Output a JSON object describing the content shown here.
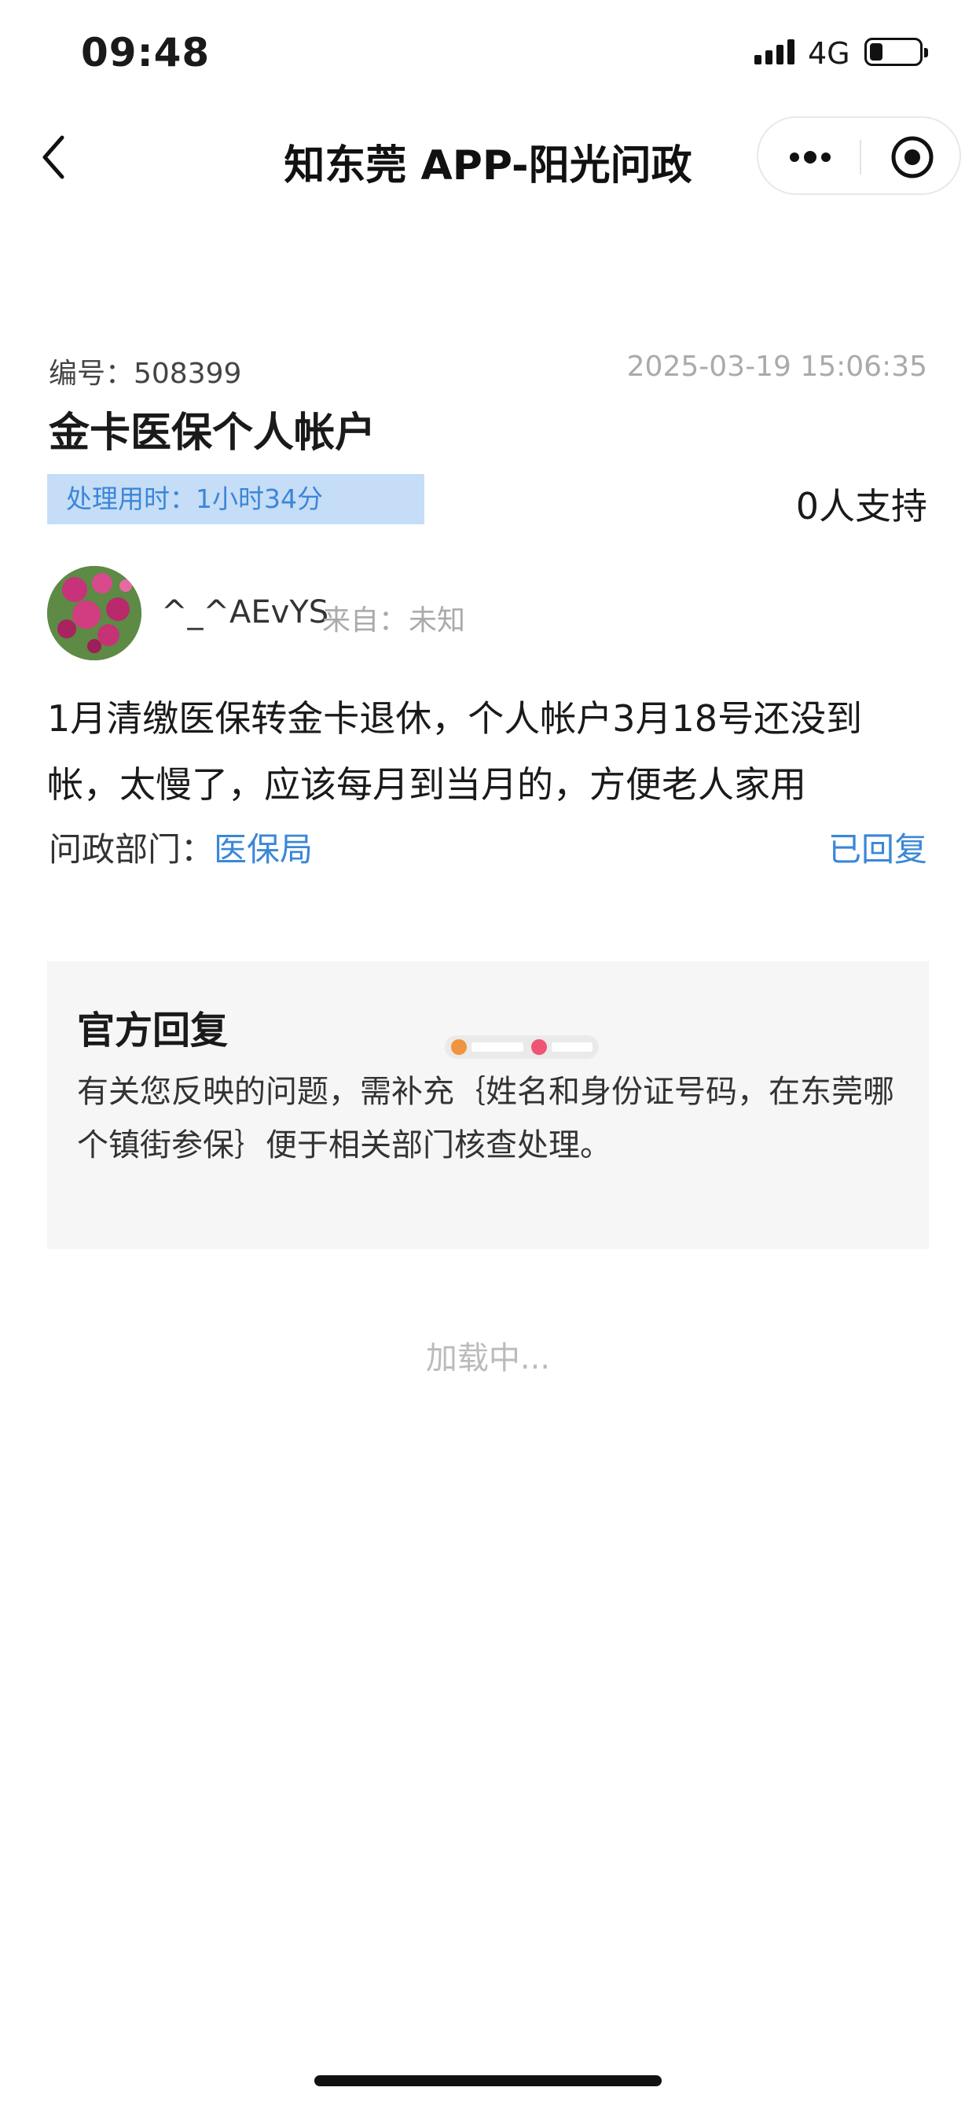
{
  "status_bar": {
    "time": "09:48",
    "network": "4G"
  },
  "nav": {
    "title": "知东莞 APP-阳光问政"
  },
  "post": {
    "number_label": "编号：508399",
    "datetime": "2025-03-19 15:06:35",
    "title": "金卡医保个人帐户",
    "processing_time": "处理用时：1小时34分",
    "support": "0人支持"
  },
  "user": {
    "name": "^_^AEvYS",
    "from_label": "来自：",
    "from_value": "未知"
  },
  "content": "1月清缴医保转金卡退休，个人帐户3月18号还没到帐，太慢了，应该每月到当月的，方便老人家用",
  "department": {
    "label": "问政部门：",
    "value": "医保局",
    "status": "已回复"
  },
  "official_reply": {
    "title": "官方回复",
    "text": "有关您反映的问题，需补充｛姓名和身份证号码，在东莞哪个镇街参保｝便于相关部门核查处理。"
  },
  "loading": "加载中...",
  "colors": {
    "accent": "#3b87d8",
    "tag_bg": "#c6ddf7",
    "card_bg": "#f6f6f6",
    "muted": "#aaaaaa"
  },
  "icons": [
    "back-chevron-icon",
    "more-dots-icon",
    "target-circle-icon",
    "signal-icon",
    "battery-icon"
  ]
}
